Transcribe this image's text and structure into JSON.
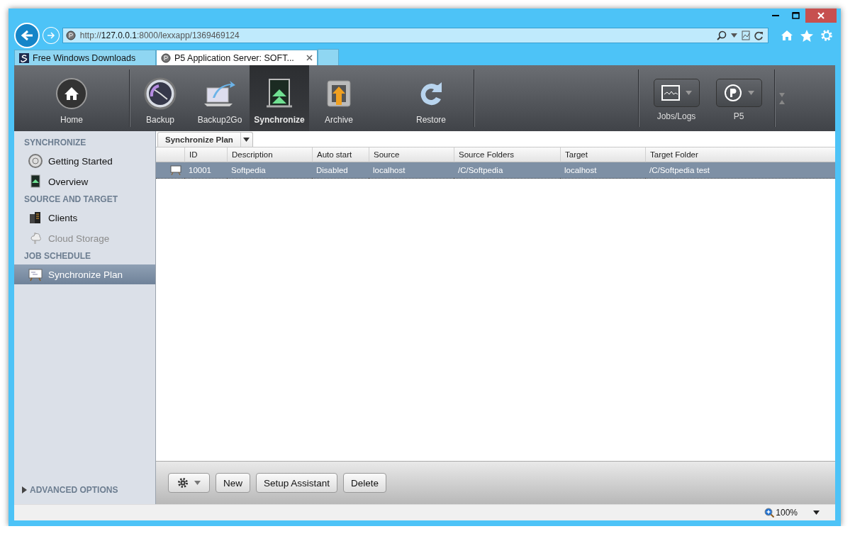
{
  "browser": {
    "url": {
      "scheme": "http://",
      "host": "127.0.0.1",
      "path": ":8000/lexxapp/1369469124"
    },
    "tabs": [
      {
        "label": "Free Windows Downloads",
        "selected": false
      },
      {
        "label": "P5 Application Server: SOFT...",
        "selected": true
      }
    ]
  },
  "toolbar": {
    "nav": [
      {
        "label": "Home",
        "kind": "home",
        "selected": false
      },
      {
        "label": "Backup",
        "kind": "backup",
        "selected": false
      },
      {
        "label": "Backup2Go",
        "kind": "laptop",
        "selected": false
      },
      {
        "label": "Synchronize",
        "kind": "sync",
        "selected": true
      },
      {
        "label": "Archive",
        "kind": "archive",
        "selected": false
      },
      {
        "label": "Restore",
        "kind": "restore",
        "selected": false
      }
    ],
    "tools": [
      {
        "label": "Jobs/Logs",
        "kind": "chart"
      },
      {
        "label": "P5",
        "kind": "p5"
      }
    ]
  },
  "sidebar": {
    "sections": [
      {
        "title": "SYNCHRONIZE",
        "items": [
          {
            "label": "Getting Started",
            "kind": "help",
            "selected": false,
            "disabled": false
          },
          {
            "label": "Overview",
            "kind": "sync",
            "selected": false,
            "disabled": false
          }
        ]
      },
      {
        "title": "SOURCE AND TARGET",
        "items": [
          {
            "label": "Clients",
            "kind": "server",
            "selected": false,
            "disabled": false
          },
          {
            "label": "Cloud Storage",
            "kind": "cloud",
            "selected": false,
            "disabled": true
          }
        ]
      },
      {
        "title": "JOB SCHEDULE",
        "items": [
          {
            "label": "Synchronize Plan",
            "kind": "plan",
            "selected": true,
            "disabled": false
          }
        ]
      }
    ],
    "advanced": {
      "label": "ADVANCED OPTIONS",
      "expanded": false
    }
  },
  "panel": {
    "tab": "Synchronize Plan",
    "table": {
      "columns": [
        "ID",
        "Description",
        "Auto start",
        "Source",
        "Source Folders",
        "Target",
        "Target Folder"
      ],
      "rows": [
        {
          "selected": true,
          "cells": [
            "10001",
            "Softpedia",
            "Disabled",
            "localhost",
            "/C/Softpedia",
            "localhost",
            "/C/Softpedia test"
          ]
        }
      ]
    },
    "buttons": [
      "New",
      "Setup Assistant",
      "Delete"
    ]
  },
  "status_bar": {
    "zoom": "100%"
  }
}
